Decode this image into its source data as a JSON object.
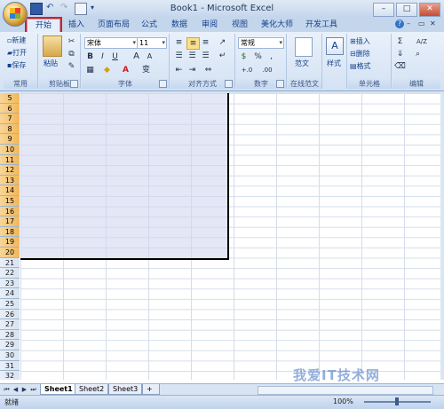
{
  "window": {
    "title": "Book1 - Microsoft Excel",
    "minimize": "–",
    "maximize": "□",
    "close": "✕"
  },
  "tabs": [
    {
      "label": "开始",
      "active": true
    },
    {
      "label": "插入"
    },
    {
      "label": "页面布局"
    },
    {
      "label": "公式"
    },
    {
      "label": "数据"
    },
    {
      "label": "审阅"
    },
    {
      "label": "视图"
    },
    {
      "label": "美化大师"
    },
    {
      "label": "开发工具"
    }
  ],
  "ribbon": {
    "common": {
      "label": "常用",
      "new": "新建",
      "open": "打开",
      "save": "保存"
    },
    "clipboard": {
      "label": "剪贴板",
      "paste": "粘贴"
    },
    "font": {
      "label": "字体",
      "font_name": "宋体",
      "font_size": "11",
      "bold": "B",
      "italic": "I",
      "underline": "U",
      "grow": "A",
      "shrink": "A"
    },
    "alignment": {
      "label": "对齐方式"
    },
    "number": {
      "label": "数字",
      "format": "常规",
      "percent": "%",
      "comma": ",",
      "inc_dec": "+.0",
      "dec_dec": ".00"
    },
    "template": {
      "label": "在线范文",
      "button": "范文"
    },
    "styles": {
      "button": "样式"
    },
    "cells": {
      "label": "单元格",
      "insert": "插入",
      "delete": "删除",
      "format": "格式"
    },
    "editing": {
      "label": "编辑",
      "sum": "Σ",
      "sort": "A/Z"
    }
  },
  "sheet": {
    "rows": [
      "5",
      "6",
      "7",
      "8",
      "9",
      "10",
      "11",
      "12",
      "13",
      "14",
      "15",
      "16",
      "17",
      "18",
      "19",
      "20",
      "21",
      "22",
      "23",
      "24",
      "25",
      "26",
      "27",
      "28",
      "29",
      "30",
      "31",
      "32"
    ],
    "selected_rows": [
      "5",
      "6",
      "7",
      "8",
      "9",
      "10",
      "11",
      "12",
      "13",
      "14",
      "15",
      "16",
      "17",
      "18",
      "19",
      "20"
    ]
  },
  "sheet_tabs": [
    "Sheet1",
    "Sheet2",
    "Sheet3"
  ],
  "status": {
    "ready": "就绪",
    "zoom": "100%"
  },
  "watermark": "我爱IT技术网"
}
